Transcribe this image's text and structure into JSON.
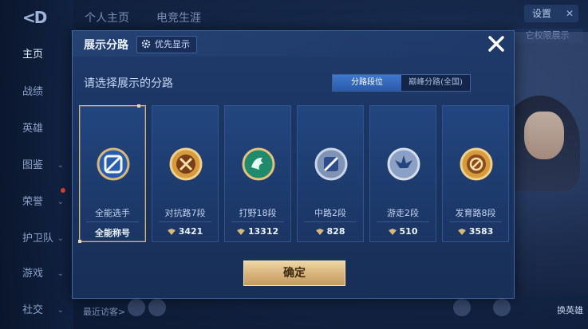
{
  "background": {
    "nav_items": [
      {
        "label": "主页",
        "active": true
      },
      {
        "label": "战绩"
      },
      {
        "label": "英雄"
      },
      {
        "label": "图鉴"
      },
      {
        "label": "荣誉"
      },
      {
        "label": "护卫队"
      },
      {
        "label": "游戏"
      },
      {
        "label": "社交"
      }
    ],
    "top_tabs": [
      "个人主页",
      "电竞生涯"
    ],
    "settings_label": "设置",
    "corner_button_label": "它权限展示",
    "swap_hero_label": "换英雄",
    "recent_visitors_label": "最近访客>"
  },
  "dialog": {
    "title": "展示分路",
    "priority_label": "优先显示",
    "subtitle": "请选择展示的分路",
    "toggle": {
      "active": "分路段位",
      "inactive": "巅峰分路(全国)"
    },
    "cards": [
      {
        "role": "全能选手",
        "score": "全能称号",
        "selected": true,
        "icon": "allround-badge-icon"
      },
      {
        "role": "对抗路7段",
        "score": "3421",
        "icon": "clash-lane-badge-icon"
      },
      {
        "role": "打野18段",
        "score": "13312",
        "icon": "jungle-badge-icon"
      },
      {
        "role": "中路2段",
        "score": "828",
        "icon": "mid-lane-badge-icon"
      },
      {
        "role": "游走2段",
        "score": "510",
        "icon": "roam-badge-icon"
      },
      {
        "role": "发育路8段",
        "score": "3583",
        "icon": "farm-lane-badge-icon"
      }
    ],
    "confirm_label": "确定"
  },
  "colors": {
    "accent_gold": "#d6b27a",
    "toggle_blue": "#3e78d0",
    "panel_blue": "#1f3b6b"
  }
}
